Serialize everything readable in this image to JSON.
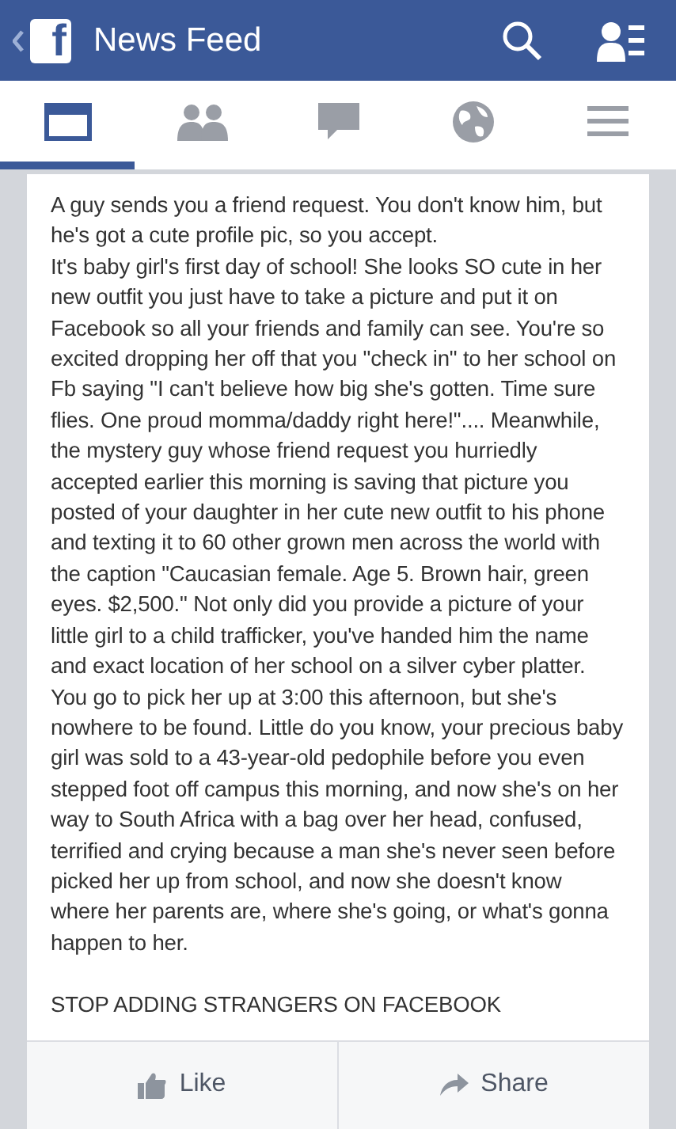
{
  "header": {
    "logo": "f",
    "title": "News Feed"
  },
  "tabs": [
    {
      "kind": "feed",
      "selected": true
    },
    {
      "kind": "friends",
      "selected": false
    },
    {
      "kind": "messages",
      "selected": false
    },
    {
      "kind": "globe",
      "selected": false
    },
    {
      "kind": "menu",
      "selected": false
    }
  ],
  "post": {
    "paragraphs": [
      "A guy sends you a friend request. You don't know him, but he's got a cute profile pic, so you accept.",
      "It's baby girl's first day of school! She looks SO cute in her new outfit you just have to take a picture and put it on Facebook so all your friends and family can see. You're so excited dropping her off that you \"check in\" to her school on Fb saying \"I can't believe how big she's gotten. Time sure flies. One proud momma/daddy right here!\".... Meanwhile, the mystery guy whose friend request you hurriedly accepted earlier this morning is saving that picture you posted of your daughter in her cute new outfit to his phone and texting it to 60 other grown men across the world with the caption \"Caucasian female. Age 5. Brown hair, green eyes. $2,500.\" Not only did you provide a picture of your little girl to a child trafficker, you've handed him the name and exact location of her school on a silver cyber platter. You go to pick her up at 3:00 this afternoon, but she's nowhere to be found. Little do you know, your precious baby girl was sold to a 43-year-old pedophile before you even stepped foot off campus this morning, and now she's on her way to South Africa with a bag over her head, confused, terrified and crying because a man she's never seen before picked her up from school, and now she doesn't know where her parents are, where she's going, or what's gonna happen to her.",
      "STOP ADDING STRANGERS ON FACEBOOK"
    ]
  },
  "actions": [
    {
      "kind": "like",
      "label": "Like"
    },
    {
      "kind": "share",
      "label": "Share"
    }
  ]
}
